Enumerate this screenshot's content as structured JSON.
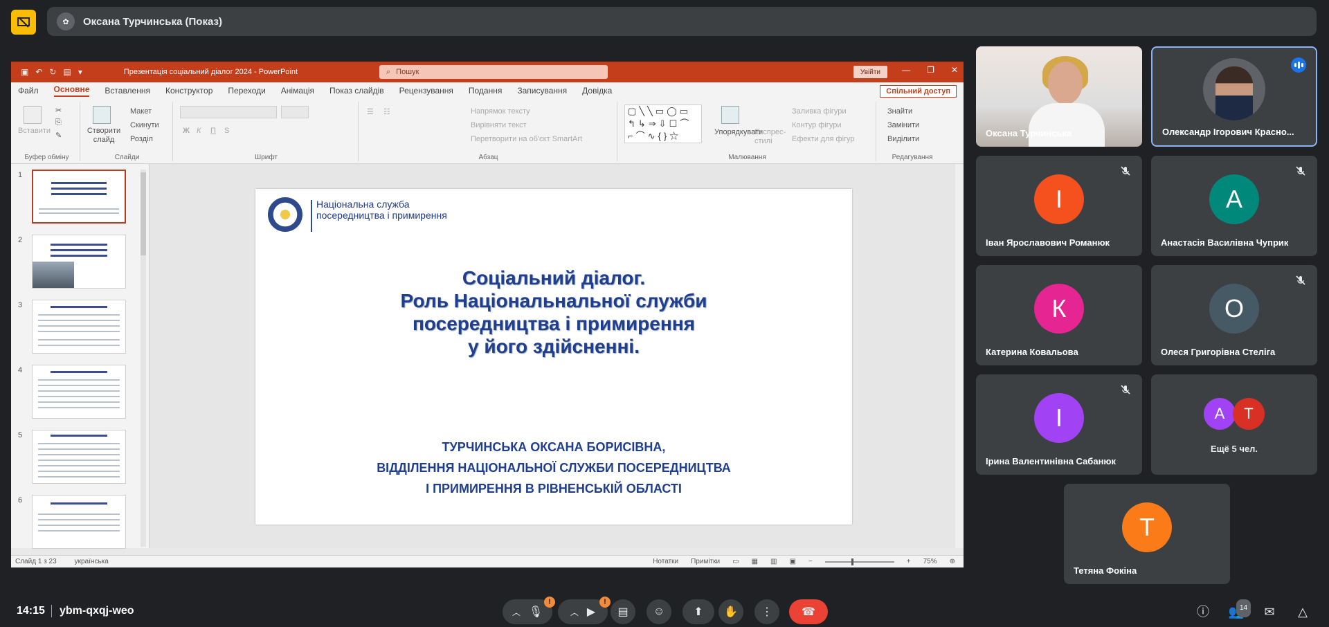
{
  "topbar": {
    "presenter_title": "Оксана Турчинська (Показ)"
  },
  "ppt": {
    "filename": "Презентація соціальний діалог 2024  -  PowerPoint",
    "search_placeholder": "Пошук",
    "login": "Увійти",
    "share": "Спільний доступ",
    "menu": [
      "Файл",
      "Основне",
      "Вставлення",
      "Конструктор",
      "Переходи",
      "Анімація",
      "Показ слайдів",
      "Рецензування",
      "Подання",
      "Записування",
      "Довідка"
    ],
    "ribbon": {
      "clipboard": "Буфер обміну",
      "paste": "Вставити",
      "slides": "Слайди",
      "new_slide": "Створити слайд",
      "layout": "Макет",
      "reset": "Скинути",
      "sections": "Розділ",
      "font": "Шрифт",
      "paragraph": "Абзац",
      "text_direction": "Напрямок тексту",
      "align_text": "Вирівняти текст",
      "smartart": "Перетворити на об'єкт SmartArt",
      "drawing": "Малювання",
      "arrange": "Упорядкувати",
      "quick_styles": "Експрес-стилі",
      "shape_fill": "Заливка фігури",
      "shape_outline": "Контур фігури",
      "shape_effects": "Ефекти для фігур",
      "editing": "Редагування",
      "find": "Знайти",
      "replace": "Замінити",
      "select": "Виділити"
    },
    "thumb_numbers": [
      "1",
      "2",
      "3",
      "4",
      "5",
      "6"
    ],
    "slide": {
      "logo_text": "Національна служба посередництва і примирення",
      "title_lines": [
        "Соціальний діалог.",
        "Роль Національнальної служби",
        "посередництва і примирення",
        "у його здійсненні."
      ],
      "author_lines": [
        "ТУРЧИНСЬКА ОКСАНА БОРИСІВНА,",
        "ВІДДІЛЕННЯ НАЦІОНАЛЬНОЇ СЛУЖБИ ПОСЕРЕДНИЦТВА",
        "І ПРИМИРЕННЯ  В РІВНЕНСЬКІЙ ОБЛАСТІ"
      ]
    },
    "status": {
      "slide_counter": "Слайд 1 з 23",
      "language": "українська",
      "notes": "Нотатки",
      "comments": "Примітки",
      "zoom": "75%"
    }
  },
  "participants": [
    {
      "name": "Оксана Турчинська",
      "type": "video"
    },
    {
      "name": "Олександр Ігорович Красно...",
      "type": "photo",
      "speaking": true
    },
    {
      "name": "Іван Ярославович Романюк",
      "letter": "І",
      "color": "#f4511e",
      "muted": true
    },
    {
      "name": "Анастасія Василівна Чуприк",
      "letter": "А",
      "color": "#00897b",
      "muted": true
    },
    {
      "name": "Катерина Ковальова",
      "letter": "К",
      "color": "#e52592"
    },
    {
      "name": "Олеся Григорівна Стеліга",
      "letter": "О",
      "color": "#455a64",
      "muted": true
    },
    {
      "name": "Ірина Валентинівна Сабанюк",
      "letter": "І",
      "color": "#a142f4",
      "muted": true
    },
    {
      "name": "Тетяна Фокіна",
      "letter": "Т",
      "color": "#fa7b17"
    }
  ],
  "more": {
    "label": "Ещё 5 чел.",
    "letters": [
      "А",
      "Т"
    ],
    "colors": [
      "#a142f4",
      "#d93025"
    ]
  },
  "bottombar": {
    "time": "14:15",
    "meeting_code": "ybm-qxqj-weo",
    "participant_count": "14",
    "warn": "!"
  }
}
